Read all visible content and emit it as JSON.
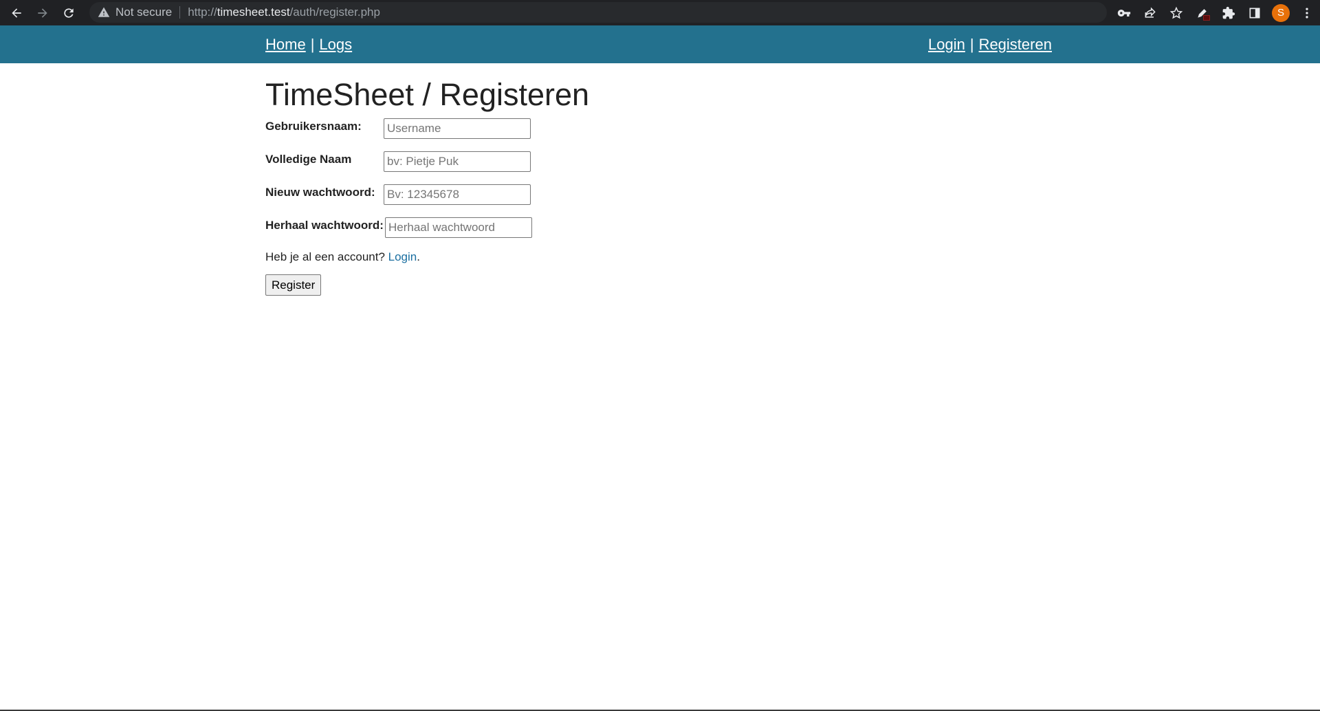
{
  "browser": {
    "security_label": "Not secure",
    "url_scheme": "http://",
    "url_host": "timesheet.test",
    "url_path": "/auth/register.php",
    "avatar_letter": "S"
  },
  "site_nav": {
    "left_links": [
      "Home",
      "Logs"
    ],
    "right_links": [
      "Login",
      "Registeren"
    ],
    "separator": "|",
    "background": "#23718e"
  },
  "page": {
    "title": "TimeSheet / Registeren"
  },
  "form": {
    "fields": [
      {
        "label": "Gebruikersnaam:",
        "placeholder": "Username",
        "value": ""
      },
      {
        "label": "Volledige Naam",
        "placeholder": "bv: Pietje Puk",
        "value": ""
      },
      {
        "label": "Nieuw wachtwoord:",
        "placeholder": "Bv: 12345678",
        "value": ""
      },
      {
        "label": "Herhaal wachtwoord:",
        "placeholder": "Herhaal wachtwoord",
        "value": ""
      }
    ],
    "account_prompt": "Heb je al een account?",
    "account_link": "Login",
    "account_suffix": ".",
    "submit_label": "Register"
  }
}
